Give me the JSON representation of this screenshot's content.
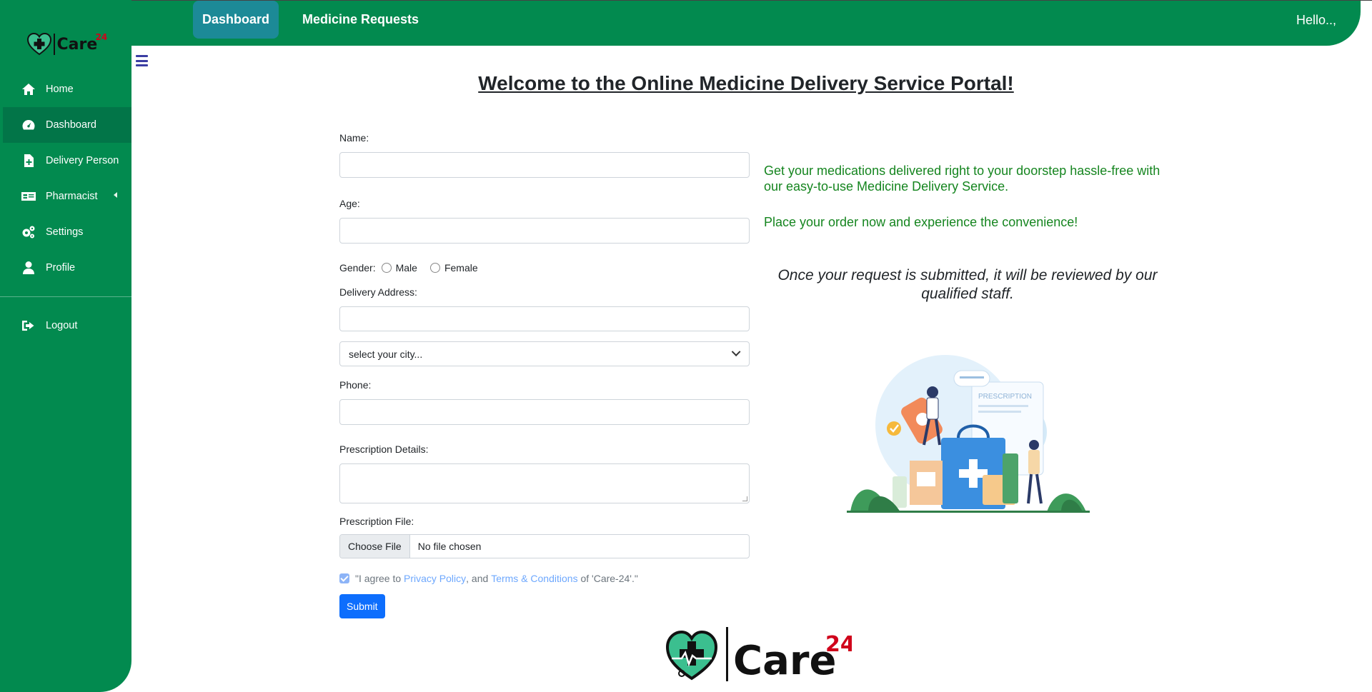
{
  "brand": {
    "name": "Care",
    "sup": "24"
  },
  "sidebar": {
    "items": [
      {
        "label": "Home",
        "icon": "home-icon"
      },
      {
        "label": "Dashboard",
        "icon": "dashboard-gauge-icon",
        "active": true
      },
      {
        "label": "Delivery Person",
        "icon": "file-plus-icon"
      },
      {
        "label": "Pharmacist",
        "icon": "id-card-icon",
        "has_submenu": true
      },
      {
        "label": "Settings",
        "icon": "gears-icon"
      },
      {
        "label": "Profile",
        "icon": "user-icon"
      }
    ],
    "logout": {
      "label": "Logout",
      "icon": "sign-out-icon"
    }
  },
  "topbar": {
    "tabs": [
      {
        "label": "Dashboard",
        "active": true
      },
      {
        "label": "Medicine Requests"
      }
    ],
    "greeting": "Hello..,"
  },
  "page": {
    "title": "Welcome to the Online Medicine Delivery Service Portal!"
  },
  "form": {
    "name_label": "Name:",
    "name_value": "",
    "age_label": "Age:",
    "age_value": "",
    "gender_label": "Gender:",
    "gender_options": [
      "Male",
      "Female"
    ],
    "address_label": "Delivery Address:",
    "address_value": "",
    "city_select": "select your city...",
    "phone_label": "Phone:",
    "phone_value": "",
    "prescription_label": "Prescription Details:",
    "prescription_value": "",
    "file_label": "Prescription File:",
    "file_button": "Choose File",
    "file_status": "No file chosen",
    "agree_prefix": "\"I agree to",
    "privacy_link": "Privacy Policy",
    "agree_and": ", and",
    "terms_link": "Terms & Conditions",
    "agree_suffix": "of 'Care-24'.\"",
    "agree_checked": true,
    "submit_label": "Submit"
  },
  "info": {
    "line1": "Get your medications delivered right to your doorstep hassle-free with our easy-to-use Medicine Delivery Service.",
    "line2": "Place your order now and experience the convenience!",
    "staff_note": "Once your request is submitted, it will be reviewed by our qualified staff."
  },
  "illustration": {
    "prescription_text": "PRESCRIPTION"
  },
  "colors": {
    "sidebar": "#028a4f",
    "sidebar_active": "#027548",
    "tab_active": "#1c8a97",
    "info_text": "#15851f",
    "submit": "#0d6efd",
    "link": "#6ea8fe",
    "logo_accent": "#d0021b"
  }
}
